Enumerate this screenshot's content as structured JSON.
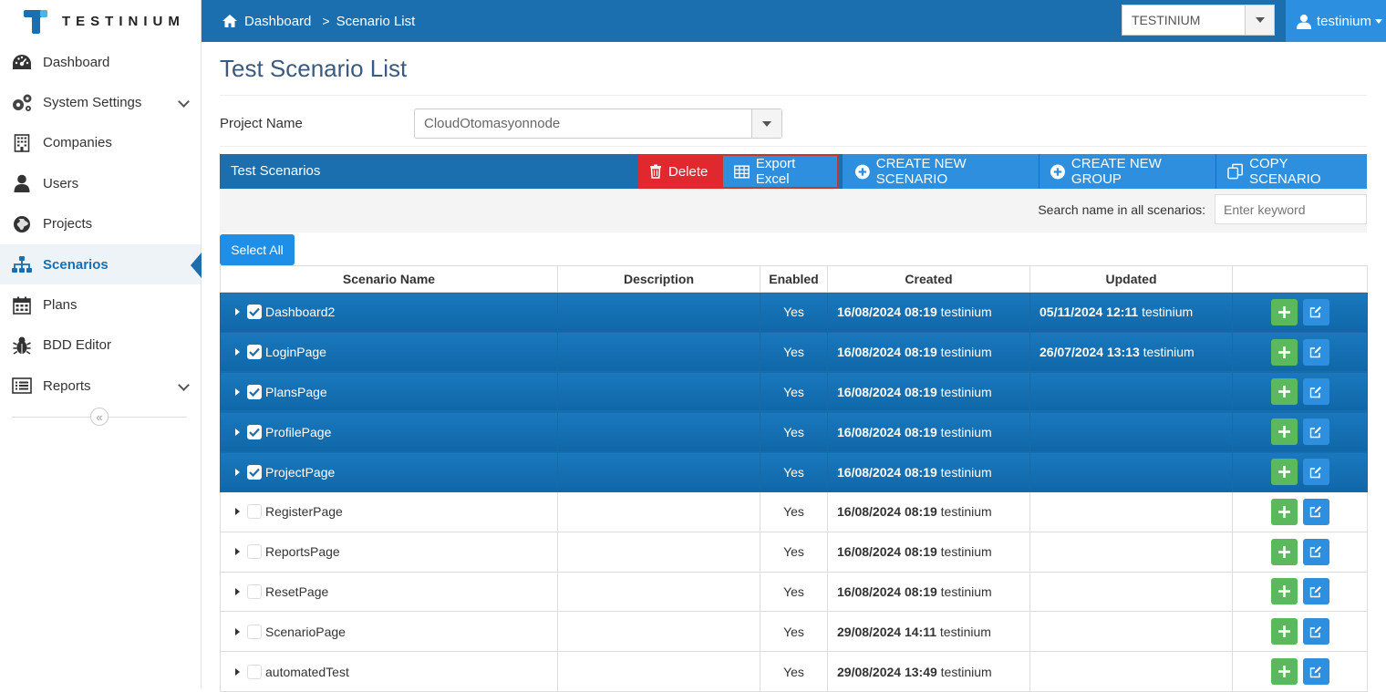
{
  "brand": {
    "name": "TESTINIUM"
  },
  "breadcrumb": {
    "home": "Dashboard",
    "current": "Scenario List"
  },
  "tenant": {
    "selected": "TESTINIUM"
  },
  "user": {
    "name": "testinium"
  },
  "sidebar": {
    "items": [
      {
        "label": "Dashboard",
        "icon": "dashboard-icon",
        "active": false,
        "expandable": false
      },
      {
        "label": "System Settings",
        "icon": "gears-icon",
        "active": false,
        "expandable": true
      },
      {
        "label": "Companies",
        "icon": "building-icon",
        "active": false,
        "expandable": false
      },
      {
        "label": "Users",
        "icon": "user-icon",
        "active": false,
        "expandable": false
      },
      {
        "label": "Projects",
        "icon": "globe-icon",
        "active": false,
        "expandable": false
      },
      {
        "label": "Scenarios",
        "icon": "sitemap-icon",
        "active": true,
        "expandable": false
      },
      {
        "label": "Plans",
        "icon": "calendar-icon",
        "active": false,
        "expandable": false
      },
      {
        "label": "BDD Editor",
        "icon": "bug-icon",
        "active": false,
        "expandable": false
      },
      {
        "label": "Reports",
        "icon": "list-icon",
        "active": false,
        "expandable": true
      }
    ],
    "collapse_glyph": "«"
  },
  "page": {
    "title": "Test Scenario List"
  },
  "project": {
    "label": "Project Name",
    "selected": "CloudOtomasyonnode"
  },
  "panel": {
    "title": "Test Scenarios",
    "delete_label": "Delete",
    "export_label": "Export Excel",
    "create_scenario_label": "CREATE NEW SCENARIO",
    "create_group_label": "CREATE NEW GROUP",
    "copy_label": "COPY SCENARIO"
  },
  "search": {
    "label": "Search name in all scenarios:",
    "placeholder": "Enter keyword",
    "value": ""
  },
  "select_all_label": "Select All",
  "table": {
    "headers": [
      "Scenario Name",
      "Description",
      "Enabled",
      "Created",
      "Updated",
      ""
    ],
    "rows": [
      {
        "name": "Dashboard2",
        "selected": true,
        "description": "",
        "enabled": "Yes",
        "created_date": "16/08/2024 08:19",
        "created_by": "testinium",
        "updated_date": "05/11/2024 12:11",
        "updated_by": "testinium"
      },
      {
        "name": "LoginPage",
        "selected": true,
        "description": "",
        "enabled": "Yes",
        "created_date": "16/08/2024 08:19",
        "created_by": "testinium",
        "updated_date": "26/07/2024 13:13",
        "updated_by": "testinium"
      },
      {
        "name": "PlansPage",
        "selected": true,
        "description": "",
        "enabled": "Yes",
        "created_date": "16/08/2024 08:19",
        "created_by": "testinium",
        "updated_date": "",
        "updated_by": ""
      },
      {
        "name": "ProfilePage",
        "selected": true,
        "description": "",
        "enabled": "Yes",
        "created_date": "16/08/2024 08:19",
        "created_by": "testinium",
        "updated_date": "",
        "updated_by": ""
      },
      {
        "name": "ProjectPage",
        "selected": true,
        "description": "",
        "enabled": "Yes",
        "created_date": "16/08/2024 08:19",
        "created_by": "testinium",
        "updated_date": "",
        "updated_by": ""
      },
      {
        "name": "RegisterPage",
        "selected": false,
        "description": "",
        "enabled": "Yes",
        "created_date": "16/08/2024 08:19",
        "created_by": "testinium",
        "updated_date": "",
        "updated_by": ""
      },
      {
        "name": "ReportsPage",
        "selected": false,
        "description": "",
        "enabled": "Yes",
        "created_date": "16/08/2024 08:19",
        "created_by": "testinium",
        "updated_date": "",
        "updated_by": ""
      },
      {
        "name": "ResetPage",
        "selected": false,
        "description": "",
        "enabled": "Yes",
        "created_date": "16/08/2024 08:19",
        "created_by": "testinium",
        "updated_date": "",
        "updated_by": ""
      },
      {
        "name": "ScenarioPage",
        "selected": false,
        "description": "",
        "enabled": "Yes",
        "created_date": "29/08/2024 14:11",
        "created_by": "testinium",
        "updated_date": "",
        "updated_by": ""
      },
      {
        "name": "automatedTest",
        "selected": false,
        "description": "",
        "enabled": "Yes",
        "created_date": "29/08/2024 13:49",
        "created_by": "testinium",
        "updated_date": "",
        "updated_by": ""
      }
    ]
  },
  "colors": {
    "primary": "#1b6fae",
    "accent": "#2d8fdd",
    "danger": "#e0282e",
    "success": "#5cb85c"
  }
}
